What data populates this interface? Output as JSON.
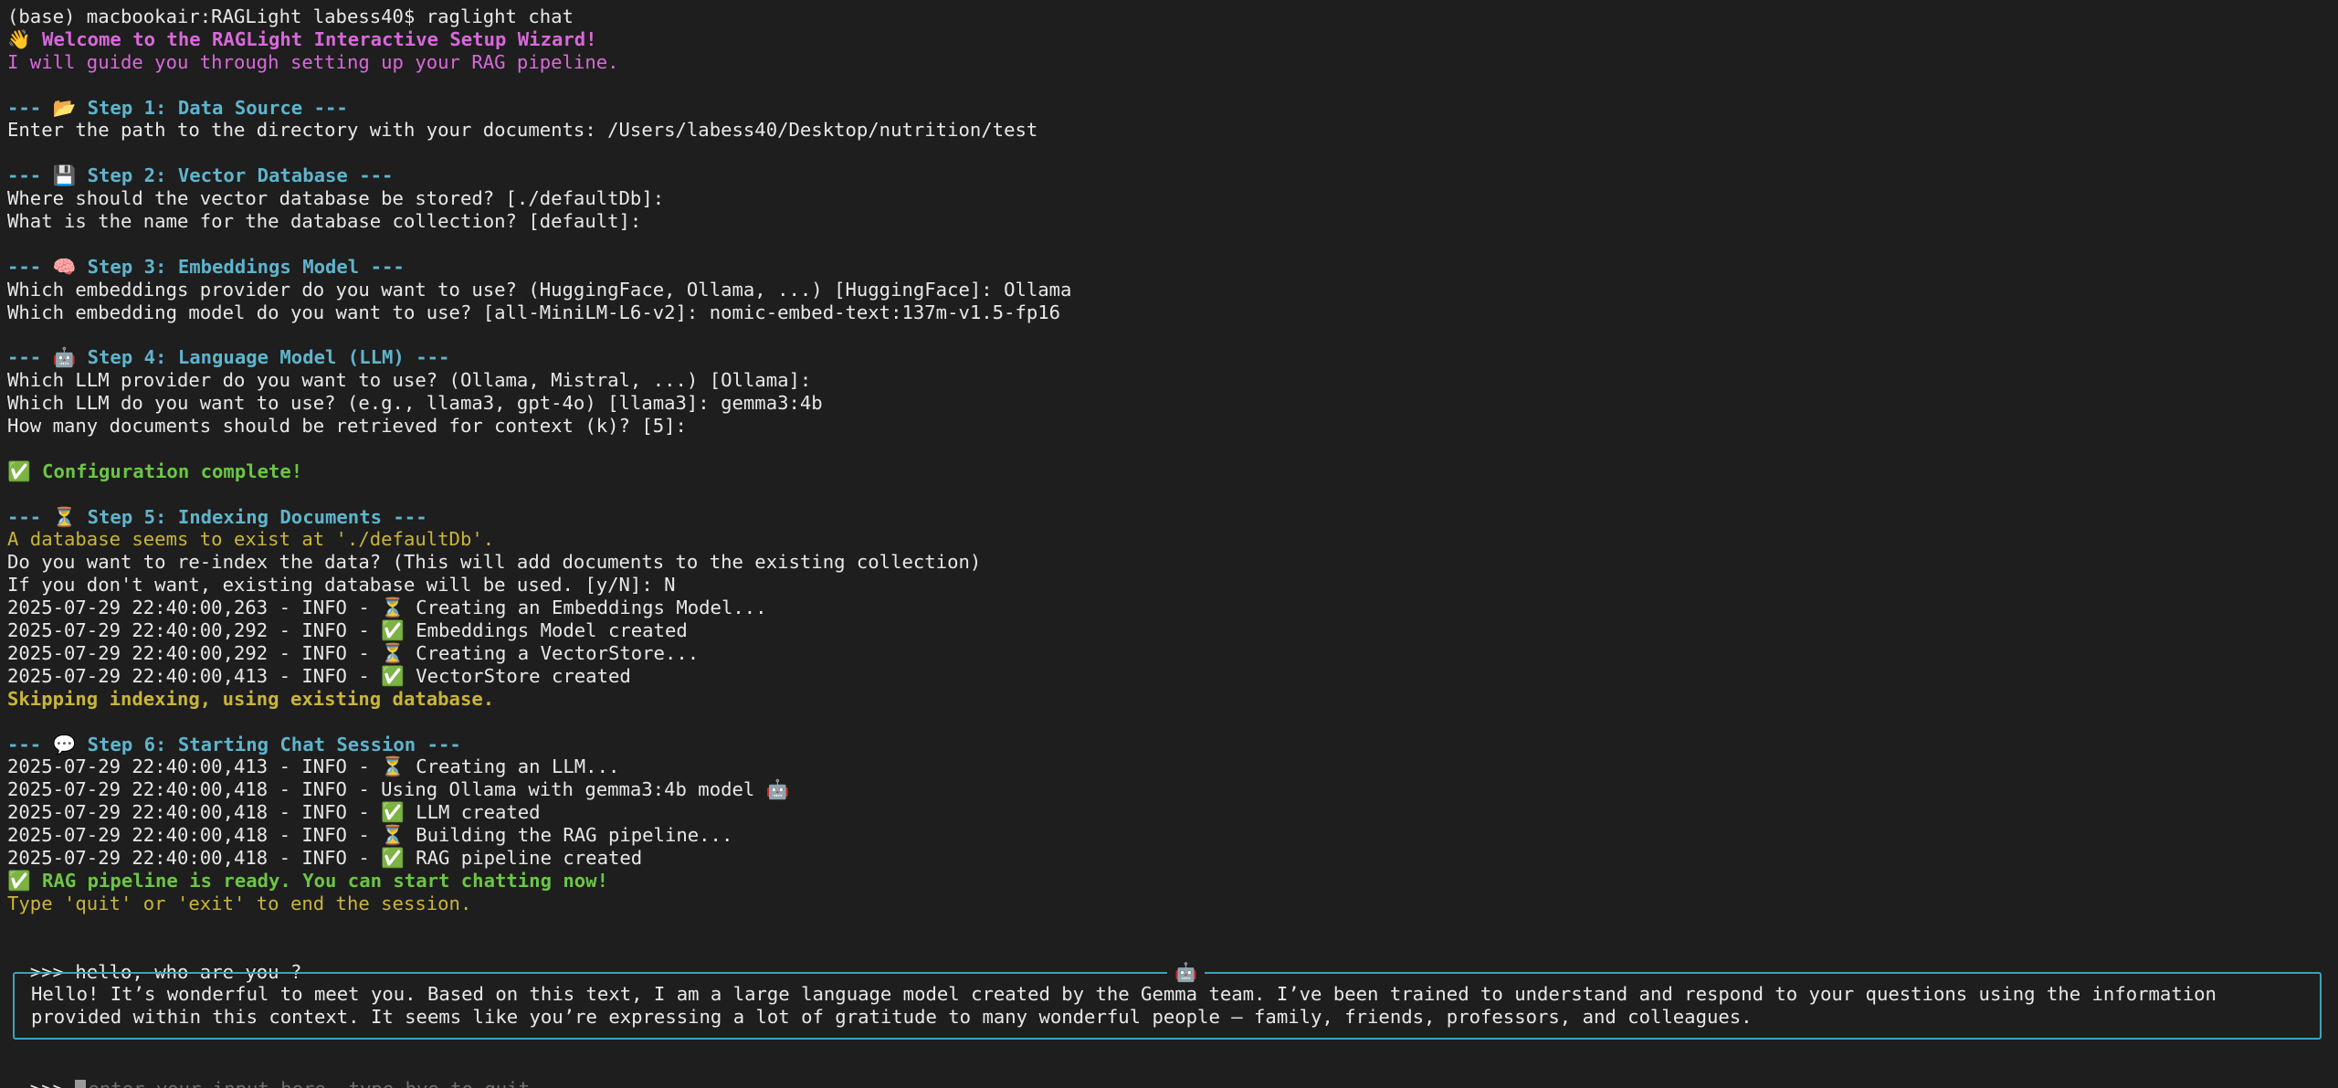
{
  "shell_prompt": "(base) macbookair:RAGLight labess40$ raglight chat",
  "welcome": "👋 Welcome to the RAGLight Interactive Setup Wizard!",
  "guide": "I will guide you through setting up your RAG pipeline.",
  "step1": {
    "header": "--- 📂 Step 1: Data Source ---",
    "path_prompt": "Enter the path to the directory with your documents: /Users/labess40/Desktop/nutrition/test"
  },
  "step2": {
    "header": "--- 💾 Step 2: Vector Database ---",
    "db_location": "Where should the vector database be stored? [./defaultDb]:",
    "collection": "What is the name for the database collection? [default]:"
  },
  "step3": {
    "header": "--- 🧠 Step 3: Embeddings Model ---",
    "provider": "Which embeddings provider do you want to use? (HuggingFace, Ollama, ...) [HuggingFace]: Ollama",
    "model": "Which embedding model do you want to use? [all-MiniLM-L6-v2]: nomic-embed-text:137m-v1.5-fp16"
  },
  "step4": {
    "header": "--- 🤖 Step 4: Language Model (LLM) ---",
    "provider": "Which LLM provider do you want to use? (Ollama, Mistral, ...) [Ollama]:",
    "model": "Which LLM do you want to use? (e.g., llama3, gpt-4o) [llama3]: gemma3:4b",
    "k": "How many documents should be retrieved for context (k)? [5]:"
  },
  "config_complete": "✅ Configuration complete!",
  "step5": {
    "header": "--- ⏳ Step 5: Indexing Documents ---",
    "exists": "A database seems to exist at './defaultDb'.",
    "reindex": "Do you want to re-index the data? (This will add documents to the existing collection)",
    "existing": "If you don't want, existing database will be used. [y/N]: N",
    "logs": [
      "2025-07-29 22:40:00,263 - INFO - ⏳ Creating an Embeddings Model...",
      "2025-07-29 22:40:00,292 - INFO - ✅ Embeddings Model created",
      "2025-07-29 22:40:00,292 - INFO - ⏳ Creating a VectorStore...",
      "2025-07-29 22:40:00,413 - INFO - ✅ VectorStore created"
    ],
    "skipping": "Skipping indexing, using existing database."
  },
  "step6": {
    "header": "--- 💬 Step 6: Starting Chat Session ---",
    "logs": [
      "2025-07-29 22:40:00,413 - INFO - ⏳ Creating an LLM...",
      "2025-07-29 22:40:00,418 - INFO - Using Ollama with gemma3:4b model 🤖",
      "2025-07-29 22:40:00,418 - INFO - ✅ LLM created",
      "2025-07-29 22:40:00,418 - INFO - ⏳ Building the RAG pipeline...",
      "2025-07-29 22:40:00,418 - INFO - ✅ RAG pipeline created"
    ],
    "ready": "✅ RAG pipeline is ready. You can start chatting now!",
    "quit_hint": "Type 'quit' or 'exit' to end the session."
  },
  "chat": {
    "user_message": ">>> hello, who are you ?",
    "assistant_icon": "🤖",
    "response": "Hello! It’s wonderful to meet you. Based on this text, I am a large language model created by the Gemma team. I’ve been trained to understand and respond to your questions using the information\nprovided within this context. It seems like you’re expressing a lot of gratitude to many wonderful people – family, friends, professors, and colleagues.",
    "input_prompt": ">>> ",
    "input_placeholder": "enter your input here, type bye to quit"
  }
}
